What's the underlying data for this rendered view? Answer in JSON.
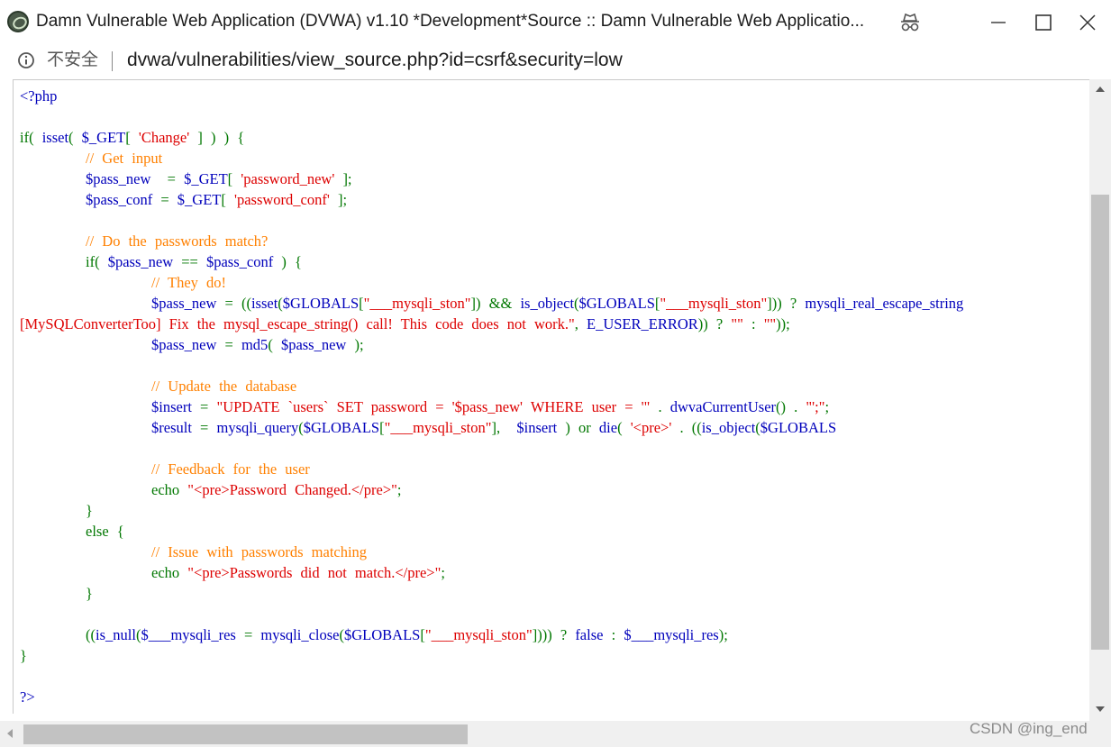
{
  "window": {
    "title": "Damn Vulnerable Web Application (DVWA) v1.10 *Development*Source :: Damn Vulnerable Web Applicatio...",
    "icons": [
      "dvwa-logo-icon",
      "incognito-icon",
      "minimize-icon",
      "maximize-icon",
      "close-icon"
    ]
  },
  "address_bar": {
    "security_label": "不安全",
    "url": "dvwa/vulnerabilities/view_source.php?id=csrf&security=low"
  },
  "colors": {
    "html": "#0000bb",
    "keyword": "#007700",
    "string": "#dd0000",
    "comment": "#ff8000"
  },
  "code_lines": [
    [
      [
        "html",
        "<?php"
      ]
    ],
    [],
    [
      [
        "keyword",
        "if( "
      ],
      [
        "default",
        "isset"
      ],
      [
        "keyword",
        "( "
      ],
      [
        "default",
        "$_GET"
      ],
      [
        "keyword",
        "[ "
      ],
      [
        "string",
        "'Change' "
      ],
      [
        "keyword",
        "] ) ) {"
      ]
    ],
    [
      [
        "comment",
        "        // Get input"
      ]
    ],
    [
      [
        "default",
        "        $pass_new  "
      ],
      [
        "keyword",
        "= "
      ],
      [
        "default",
        "$_GET"
      ],
      [
        "keyword",
        "[ "
      ],
      [
        "string",
        "'password_new' "
      ],
      [
        "keyword",
        "];"
      ]
    ],
    [
      [
        "default",
        "        $pass_conf "
      ],
      [
        "keyword",
        "= "
      ],
      [
        "default",
        "$_GET"
      ],
      [
        "keyword",
        "[ "
      ],
      [
        "string",
        "'password_conf' "
      ],
      [
        "keyword",
        "];"
      ]
    ],
    [],
    [
      [
        "comment",
        "        // Do the passwords match?"
      ]
    ],
    [
      [
        "keyword",
        "        if( "
      ],
      [
        "default",
        "$pass_new "
      ],
      [
        "keyword",
        "== "
      ],
      [
        "default",
        "$pass_conf "
      ],
      [
        "keyword",
        ") {"
      ]
    ],
    [
      [
        "comment",
        "                // They do!"
      ]
    ],
    [
      [
        "default",
        "                $pass_new "
      ],
      [
        "keyword",
        "= (("
      ],
      [
        "default",
        "isset"
      ],
      [
        "keyword",
        "("
      ],
      [
        "default",
        "$GLOBALS"
      ],
      [
        "keyword",
        "["
      ],
      [
        "string",
        "\"___mysqli_ston\""
      ],
      [
        "keyword",
        "]) && "
      ],
      [
        "default",
        "is_object"
      ],
      [
        "keyword",
        "("
      ],
      [
        "default",
        "$GLOBALS"
      ],
      [
        "keyword",
        "["
      ],
      [
        "string",
        "\"___mysqli_ston\""
      ],
      [
        "keyword",
        "])) ? "
      ],
      [
        "default",
        "mysqli_real_escape_string"
      ]
    ],
    [
      [
        "string",
        "[MySQLConverterToo] Fix the mysql_escape_string() call! This code does not work.\""
      ],
      [
        "keyword",
        ", "
      ],
      [
        "default",
        "E_USER_ERROR"
      ],
      [
        "keyword",
        ")) ? "
      ],
      [
        "string",
        "\"\" "
      ],
      [
        "keyword",
        ": "
      ],
      [
        "string",
        "\"\""
      ],
      [
        "keyword",
        "));"
      ]
    ],
    [
      [
        "default",
        "                $pass_new "
      ],
      [
        "keyword",
        "= "
      ],
      [
        "default",
        "md5"
      ],
      [
        "keyword",
        "( "
      ],
      [
        "default",
        "$pass_new "
      ],
      [
        "keyword",
        ");"
      ]
    ],
    [],
    [
      [
        "comment",
        "                // Update the database"
      ]
    ],
    [
      [
        "default",
        "                $insert "
      ],
      [
        "keyword",
        "= "
      ],
      [
        "string",
        "\"UPDATE `users` SET password = '$pass_new' WHERE user = '\" "
      ],
      [
        "keyword",
        ". "
      ],
      [
        "default",
        "dwvaCurrentUser"
      ],
      [
        "keyword",
        "() . "
      ],
      [
        "string",
        "\"';\""
      ],
      [
        "keyword",
        ";"
      ]
    ],
    [
      [
        "default",
        "                $result "
      ],
      [
        "keyword",
        "= "
      ],
      [
        "default",
        "mysqli_query"
      ],
      [
        "keyword",
        "("
      ],
      [
        "default",
        "$GLOBALS"
      ],
      [
        "keyword",
        "["
      ],
      [
        "string",
        "\"___mysqli_ston\""
      ],
      [
        "keyword",
        "],  "
      ],
      [
        "default",
        "$insert "
      ],
      [
        "keyword",
        ") or "
      ],
      [
        "default",
        "die"
      ],
      [
        "keyword",
        "( "
      ],
      [
        "string",
        "'<pre>' "
      ],
      [
        "keyword",
        ". (("
      ],
      [
        "default",
        "is_object"
      ],
      [
        "keyword",
        "("
      ],
      [
        "default",
        "$GLOBALS"
      ]
    ],
    [],
    [
      [
        "comment",
        "                // Feedback for the user"
      ]
    ],
    [
      [
        "keyword",
        "                echo "
      ],
      [
        "string",
        "\"<pre>Password Changed.</pre>\""
      ],
      [
        "keyword",
        ";"
      ]
    ],
    [
      [
        "keyword",
        "        }"
      ]
    ],
    [
      [
        "keyword",
        "        else {"
      ]
    ],
    [
      [
        "comment",
        "                // Issue with passwords matching"
      ]
    ],
    [
      [
        "keyword",
        "                echo "
      ],
      [
        "string",
        "\"<pre>Passwords did not match.</pre>\""
      ],
      [
        "keyword",
        ";"
      ]
    ],
    [
      [
        "keyword",
        "        }"
      ]
    ],
    [],
    [
      [
        "keyword",
        "        (("
      ],
      [
        "default",
        "is_null"
      ],
      [
        "keyword",
        "("
      ],
      [
        "default",
        "$___mysqli_res "
      ],
      [
        "keyword",
        "= "
      ],
      [
        "default",
        "mysqli_close"
      ],
      [
        "keyword",
        "("
      ],
      [
        "default",
        "$GLOBALS"
      ],
      [
        "keyword",
        "["
      ],
      [
        "string",
        "\"___mysqli_ston\""
      ],
      [
        "keyword",
        "]))) ? "
      ],
      [
        "default",
        "false "
      ],
      [
        "keyword",
        ": "
      ],
      [
        "default",
        "$___mysqli_res"
      ],
      [
        "keyword",
        ");"
      ]
    ],
    [
      [
        "keyword",
        "}"
      ]
    ],
    [],
    [
      [
        "html",
        "?>"
      ]
    ]
  ],
  "watermark": "CSDN @ing_end"
}
